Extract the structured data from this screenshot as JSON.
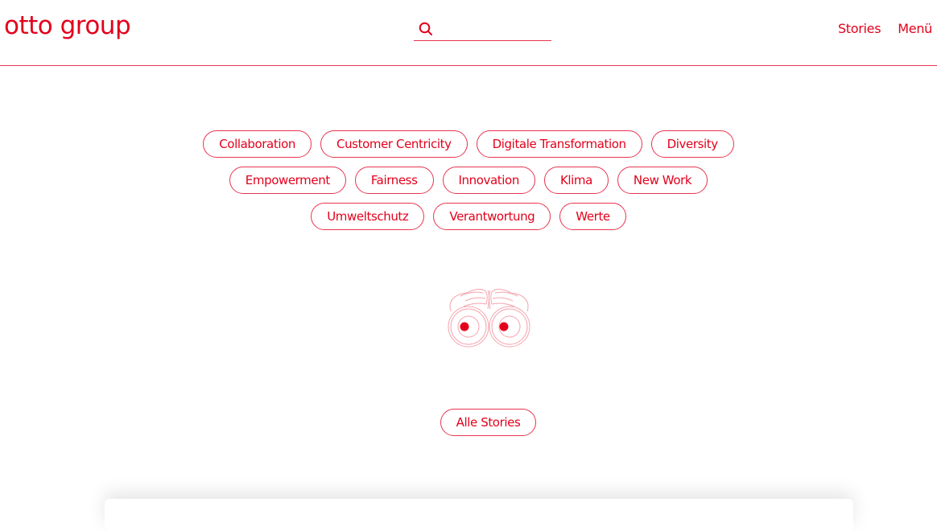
{
  "colors": {
    "brand": "#e3001b",
    "border": "#e8344e",
    "background": "#ffffff"
  },
  "header": {
    "logo": "otto group",
    "search": {
      "icon": "search-icon",
      "value": "",
      "placeholder": ""
    },
    "nav": [
      {
        "label": "Stories"
      },
      {
        "label": "Menü"
      }
    ]
  },
  "tags": {
    "rows": [
      [
        "Collaboration",
        "Customer Centricity",
        "Digitale Transformation",
        "Diversity"
      ],
      [
        "Empowerment",
        "Fairness",
        "Innovation",
        "Klima",
        "New Work"
      ],
      [
        "Umweltschutz",
        "Verantwortung",
        "Werte"
      ]
    ]
  },
  "illustration": {
    "icon": "binoculars-icon"
  },
  "cta": {
    "label": "Alle Stories"
  }
}
